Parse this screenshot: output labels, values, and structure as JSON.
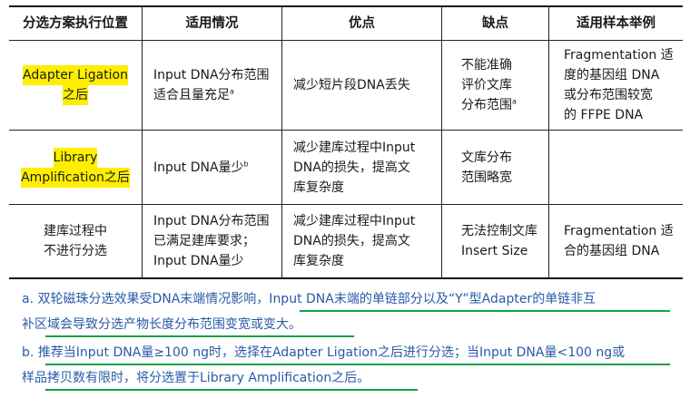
{
  "headers": [
    "分选方案执行位置",
    "适用情况",
    "优点",
    "缺点",
    "适用样本举例"
  ],
  "rows": [
    {
      "position": [
        "Adapter Ligation",
        "之后"
      ],
      "situation": [
        "Input DNA分布范围",
        "适合且量充足"
      ],
      "situation_sup": "a",
      "pros": [
        "减少短片段DNA丢失"
      ],
      "cons": [
        "不能准确",
        "评价文库",
        "分布范围"
      ],
      "cons_sup": "a",
      "examples": [
        "Fragmentation 适",
        "度的基因组 DNA",
        "或分布范围较宽",
        "的 FFPE DNA"
      ]
    },
    {
      "position": [
        "Library",
        "Amplification之后"
      ],
      "situation": [
        "Input DNA量少"
      ],
      "situation_sup": "b",
      "pros": [
        "减少建库过程中Input",
        "DNA的损失，提高文",
        "库复杂度"
      ],
      "cons": [
        "文库分布",
        "范围略宽"
      ],
      "examples": []
    },
    {
      "position": [
        "建库过程中",
        "不进行分选"
      ],
      "situation": [
        "Input DNA分布范围",
        "已满足建库要求；",
        "Input DNA量少"
      ],
      "pros": [
        "减少建库过程中Input",
        "DNA的损失，提高文",
        "库复杂度"
      ],
      "cons": [
        "无法控制文库",
        "Insert Size"
      ],
      "examples": [
        "Fragmentation 适",
        "合的基因组 DNA"
      ]
    }
  ],
  "notes": [
    {
      "line1": "a.  双轮磁珠分选效果受DNA末端情况影响，Input  DNA末端的单链部分以及“Y”型Adapter的单链非互",
      "line2": "补区域会导致分选产物长度分布范围变宽或变大。"
    },
    {
      "line1": "b.  推荐当Input  DNA量≥100  ng时，选择在Adapter  Ligation之后进行分选；当Input  DNA量<100  ng或",
      "line2": "样品拷贝数有限时，将分选置于Library Amplification之后。"
    }
  ],
  "colors": {
    "highlight": "#ffee00",
    "note_text": "#2a5aa8",
    "underline": "#12a24a"
  }
}
